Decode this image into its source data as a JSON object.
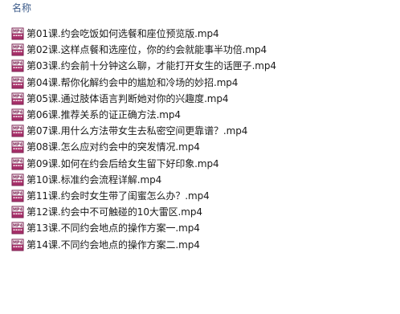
{
  "header": {
    "column_name": "名称"
  },
  "icon": {
    "name": "mp4-file-icon",
    "label": "MP4",
    "frame_color": "#7a1f4f",
    "band_color": "#a8306a"
  },
  "files": [
    {
      "name": "第01课.约会吃饭如何选餐和座位预览版.mp4"
    },
    {
      "name": "第02课.这样点餐和选座位，你的约会就能事半功倍.mp4"
    },
    {
      "name": "第03课.约会前十分钟这么聊，才能打开女生的话匣子.mp4"
    },
    {
      "name": "第04课.帮你化解约会中的尴尬和冷场的妙招.mp4"
    },
    {
      "name": "第05课.通过肢体语言判断她对你的兴趣度.mp4"
    },
    {
      "name": "第06课.推荐关系的证正确方法.mp4"
    },
    {
      "name": "第07课.用什么方法带女生去私密空间更靠谱？.mp4"
    },
    {
      "name": "第08课.怎么应对约会中的突发情况.mp4"
    },
    {
      "name": "第09课.如何在约会后给女生留下好印象.mp4"
    },
    {
      "name": "第10课.标准约会流程详解.mp4"
    },
    {
      "name": "第11课.约会时女生带了闺蜜怎么办？.mp4"
    },
    {
      "name": "第12课.约会中不可触碰的10大雷区.mp4"
    },
    {
      "name": "第13课.不同约会地点的操作方案一.mp4"
    },
    {
      "name": "第14课.不同约会地点的操作方案二.mp4"
    }
  ]
}
